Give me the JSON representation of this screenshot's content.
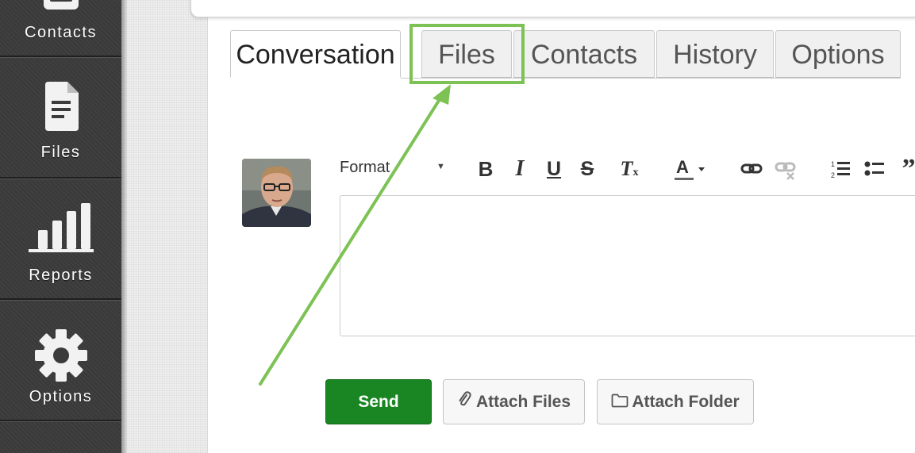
{
  "sidebar": {
    "items": [
      {
        "label": "Contacts",
        "icon": "contacts-icon"
      },
      {
        "label": "Files",
        "icon": "file-icon"
      },
      {
        "label": "Reports",
        "icon": "bar-chart-icon"
      },
      {
        "label": "Options",
        "icon": "gear-icon"
      }
    ]
  },
  "tabs": [
    {
      "label": "Conversation",
      "active": true
    },
    {
      "label": "Files",
      "active": false,
      "highlighted": true
    },
    {
      "label": "Contacts",
      "active": false
    },
    {
      "label": "History",
      "active": false
    },
    {
      "label": "Options",
      "active": false
    }
  ],
  "editor": {
    "format_label": "Format",
    "toolbar": [
      "bold-icon",
      "italic-icon",
      "underline-icon",
      "strikethrough-icon",
      "clear-format-icon",
      "text-color-icon",
      "link-icon",
      "unlink-icon",
      "numbered-list-icon",
      "bullet-list-icon",
      "blockquote-icon"
    ],
    "body": ""
  },
  "actions": {
    "send": "Send",
    "attach_files": "Attach Files",
    "attach_folder": "Attach Folder"
  },
  "colors": {
    "send": "#1a8623",
    "highlight": "#7cc254",
    "sidebar": "#3b3b3b"
  }
}
